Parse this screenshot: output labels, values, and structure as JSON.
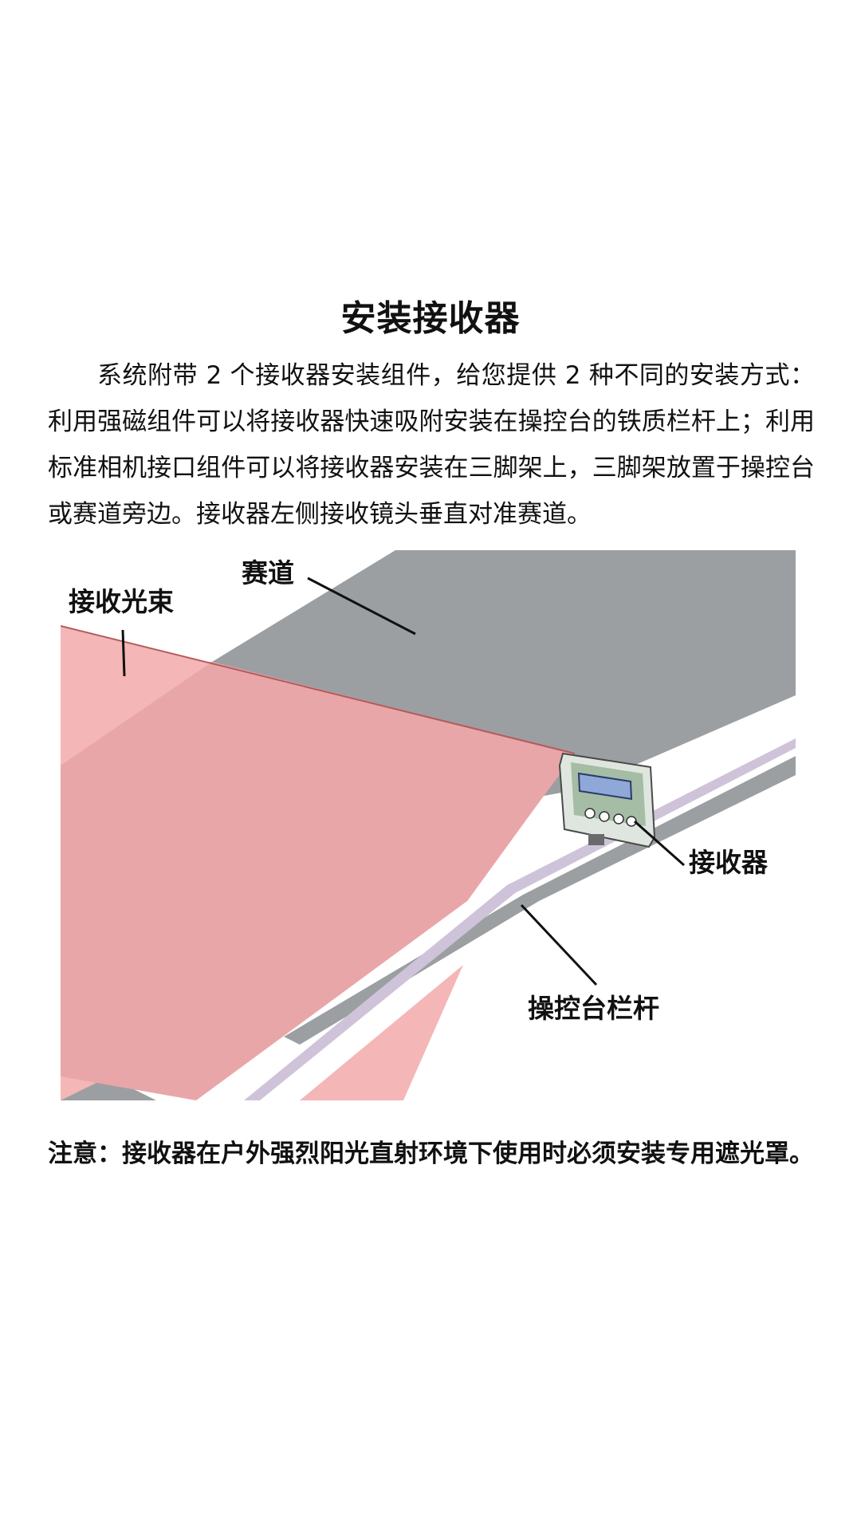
{
  "title": "安装接收器",
  "paragraph": "系统附带 2 个接收器安装组件，给您提供 2 种不同的安装方式：利用强磁组件可以将接收器快速吸附安装在操控台的铁质栏杆上；利用标准相机接口组件可以将接收器安装在三脚架上，三脚架放置于操控台或赛道旁边。接收器左侧接收镜头垂直对准赛道。",
  "figure": {
    "labels": {
      "track": "赛道",
      "beam": "接收光束",
      "receiver": "接收器",
      "railing": "操控台栏杆"
    },
    "colors": {
      "track": "#9c9fa1",
      "beam": "#f4b6b6",
      "beam_overlap": "#e9a6a8",
      "railing": "#ffffff",
      "rail_edge": "#cfc3d9",
      "device_body": "#dfe6df",
      "device_pcb": "#7fa07f",
      "device_screen": "#8fa8d8"
    }
  },
  "note": "注意：接收器在户外强烈阳光直射环境下使用时必须安装专用遮光罩。"
}
